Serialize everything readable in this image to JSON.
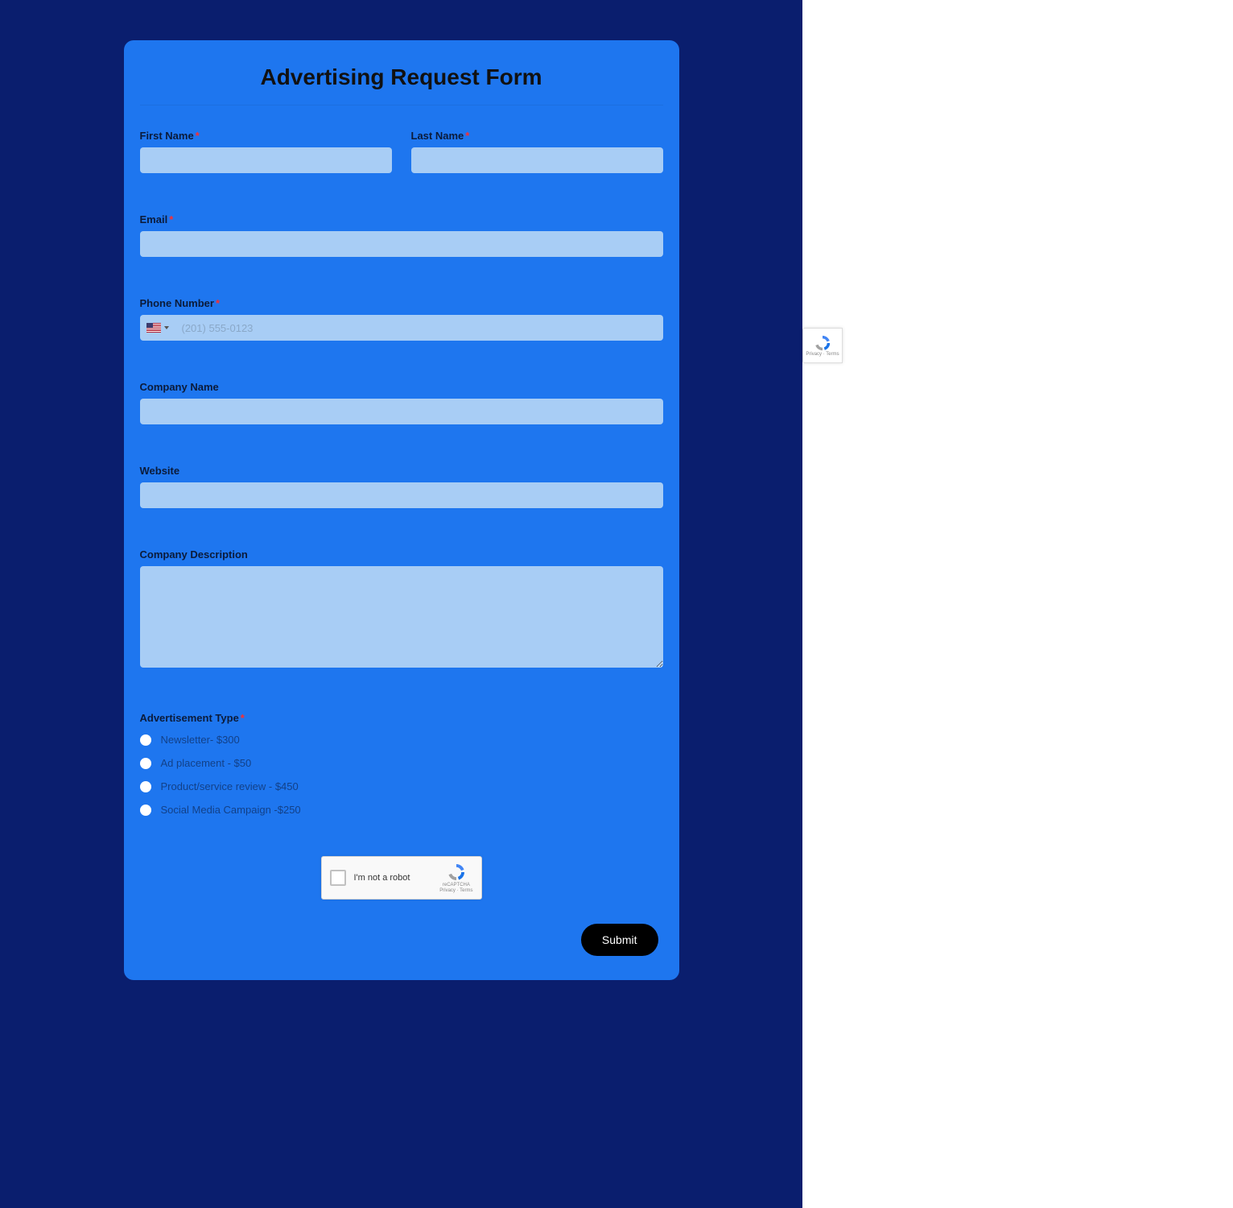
{
  "form": {
    "title": "Advertising Request Form",
    "first_name": {
      "label": "First Name",
      "required": true,
      "value": ""
    },
    "last_name": {
      "label": "Last Name",
      "required": true,
      "value": ""
    },
    "email": {
      "label": "Email",
      "required": true,
      "value": ""
    },
    "phone": {
      "label": "Phone Number",
      "required": true,
      "value": "",
      "placeholder": "(201) 555-0123",
      "country": "US"
    },
    "company_name": {
      "label": "Company Name",
      "required": false,
      "value": ""
    },
    "website": {
      "label": "Website",
      "required": false,
      "value": ""
    },
    "company_description": {
      "label": "Company Description",
      "required": false,
      "value": ""
    },
    "ad_type": {
      "label": "Advertisement Type",
      "required": true,
      "options": [
        "Newsletter- $300",
        "Ad placement - $50",
        "Product/service review - $450",
        "Social Media Campaign -$250"
      ]
    },
    "captcha": {
      "text": "I'm not a robot",
      "brand": "reCAPTCHA",
      "links": "Privacy · Terms"
    },
    "submit_label": "Submit"
  },
  "required_mark": "*",
  "side_badge": {
    "links": "Privacy · Terms"
  }
}
